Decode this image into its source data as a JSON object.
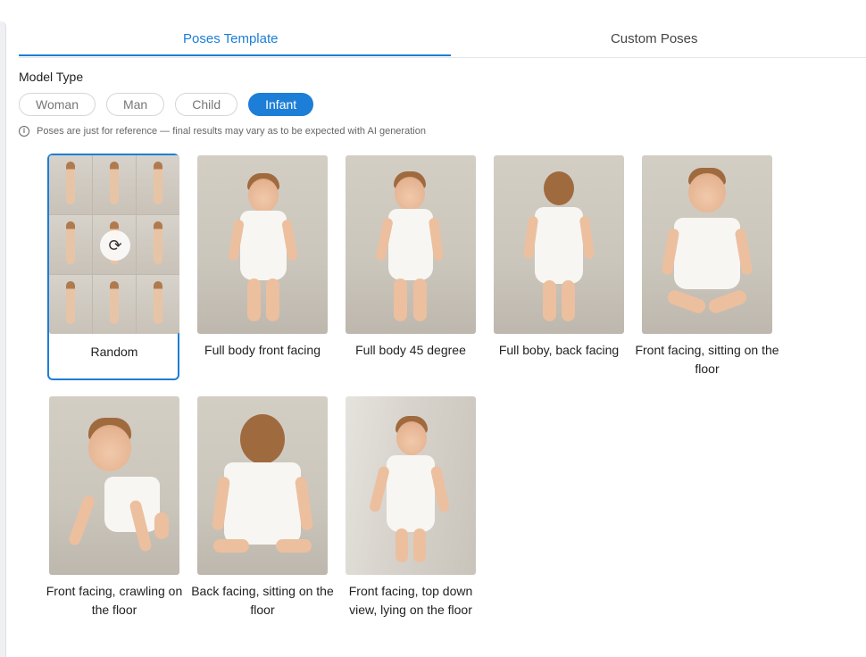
{
  "tabs": [
    {
      "label": "Poses Template",
      "active": true
    },
    {
      "label": "Custom Poses",
      "active": false
    }
  ],
  "model_type": {
    "label": "Model Type",
    "options": [
      "Woman",
      "Man",
      "Child",
      "Infant"
    ],
    "selected": "Infant"
  },
  "notice": {
    "icon": "info-icon",
    "text": "Poses are just for reference — final results may vary as to be expected with AI generation"
  },
  "poses": [
    {
      "label": "Random",
      "selected": true,
      "icon": "random-refresh-icon"
    },
    {
      "label": "Full body front facing"
    },
    {
      "label": "Full body 45 degree"
    },
    {
      "label": "Full boby, back facing"
    },
    {
      "label": "Front facing, sitting on the floor"
    },
    {
      "label": "Front facing, crawling on the floor"
    },
    {
      "label": "Back facing, sitting on the floor"
    },
    {
      "label": "Front facing, top down view, lying on the floor"
    }
  ],
  "colors": {
    "accent": "#1c7ed6",
    "border": "#e3e5e8"
  }
}
